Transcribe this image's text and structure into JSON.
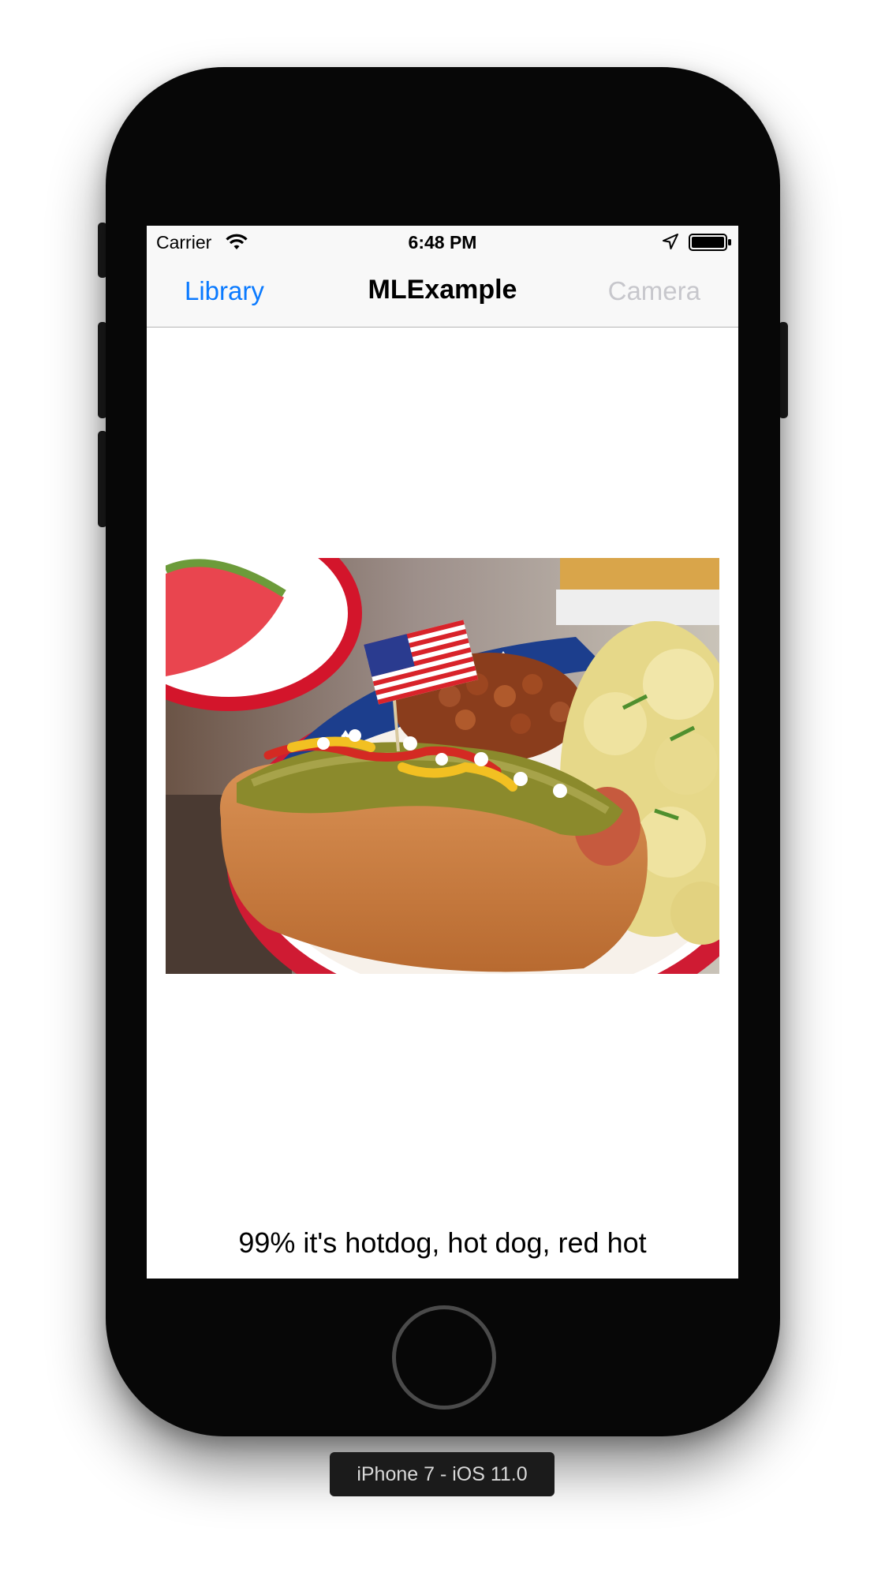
{
  "status_bar": {
    "carrier": "Carrier",
    "time": "6:48 PM",
    "icons": [
      "wifi-icon",
      "location-arrow-icon",
      "battery-icon"
    ]
  },
  "nav_bar": {
    "left_button": "Library",
    "title": "MLExample",
    "right_button": "Camera",
    "right_button_enabled": false
  },
  "photo": {
    "subject": "hotdog-photo"
  },
  "prediction": {
    "text": "99% it's hotdog, hot dog, red hot"
  },
  "simulator": {
    "device_label": "iPhone 7 - iOS 11.0"
  },
  "colors": {
    "accent": "#0a7aff",
    "disabled": "#c7c7cc",
    "nav_background": "#f8f8f8",
    "bezel": "#070707"
  }
}
